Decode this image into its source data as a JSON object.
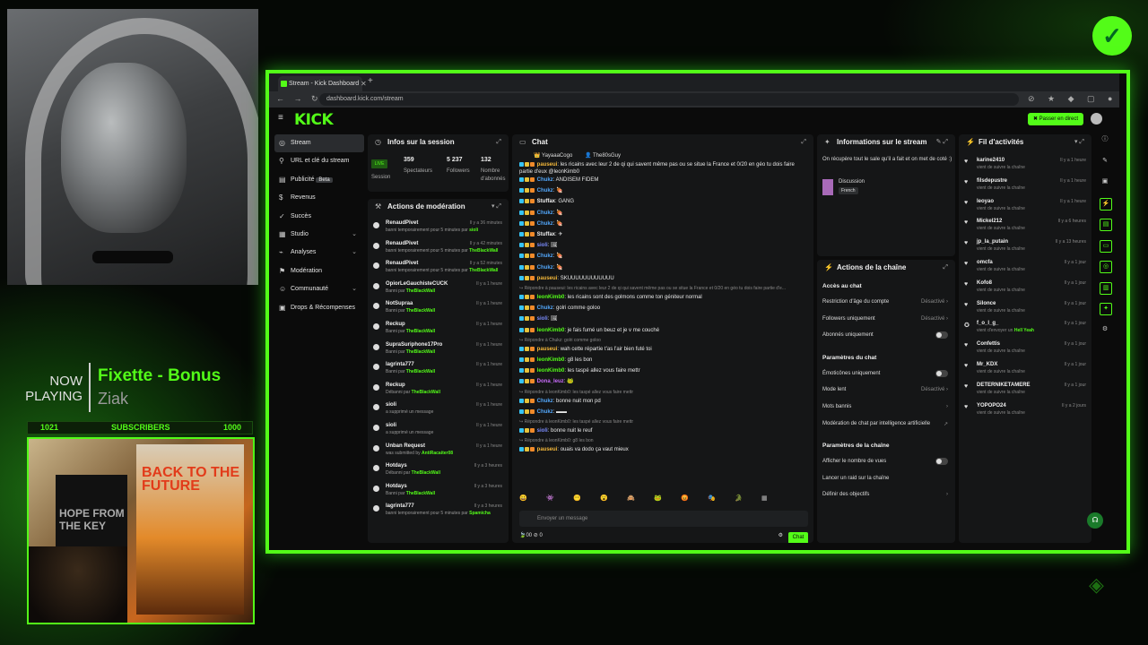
{
  "overlay": {
    "now": "NOW",
    "playing": "PLAYING",
    "song_title": "Fixette - Bonus",
    "artist": "Ziak",
    "sub_left": "1021",
    "sub_label": "SUBSCRIBERS",
    "sub_right": "1000",
    "poster_text_1": "BACK TO THE FUTURE",
    "poster_text_2": "HOPE FROM THE KEY"
  },
  "browser": {
    "tab_title": "Stream - Kick Dashboard",
    "url": "dashboard.kick.com/stream",
    "nav_icons": "← → ↻",
    "ext_icons": "⊘ ★ ◆ ▢ ●"
  },
  "app": {
    "logo": "KICK",
    "go_live": "✖ Passer en direct",
    "sidebar": [
      {
        "label": "Stream",
        "icon": "◎",
        "chev": ""
      },
      {
        "label": "URL et clé du stream",
        "icon": "⚲",
        "chev": ""
      },
      {
        "label": "Publicité",
        "icon": "▤",
        "chev": "",
        "badge": "Beta"
      },
      {
        "label": "Revenus",
        "icon": "$",
        "chev": ""
      },
      {
        "label": "Succès",
        "icon": "✓",
        "chev": ""
      },
      {
        "label": "Studio",
        "icon": "▦",
        "chev": "⌄"
      },
      {
        "label": "Analyses",
        "icon": "⌁",
        "chev": "⌄"
      },
      {
        "label": "Modération",
        "icon": "⚑",
        "chev": ""
      },
      {
        "label": "Communauté",
        "icon": "☺",
        "chev": "⌄"
      },
      {
        "label": "Drops & Récompenses",
        "icon": "▣",
        "chev": ""
      }
    ],
    "session": {
      "title": "Infos sur la session",
      "live_label": "LIVE",
      "session_label": "Session",
      "spectators_value": "359",
      "spectators_label": "Spectateurs",
      "followers_value": "5 237",
      "followers_label": "Followers",
      "subs_value": "132",
      "subs_label": "Nombre d'abonnés"
    },
    "moderation": {
      "title": "Actions de modération",
      "items": [
        {
          "user": "RenaudPivet",
          "time": "Il y a 36 minutes",
          "desc": "banni temporairement pour 5 minutes par ",
          "by": "sioli"
        },
        {
          "user": "RenaudPivet",
          "time": "Il y a 42 minutes",
          "desc": "banni temporairement pour 5 minutes par ",
          "by": "TheBlackWall"
        },
        {
          "user": "RenaudPivet",
          "time": "Il y a 52 minutes",
          "desc": "banni temporairement pour 5 minutes par ",
          "by": "TheBlackWall"
        },
        {
          "user": "OpiorLeGauchisteCUCK",
          "time": "Il y a 1 heure",
          "desc": "Banni par ",
          "by": "TheBlackWall"
        },
        {
          "user": "NotSupraa",
          "time": "Il y a 1 heure",
          "desc": "Banni par ",
          "by": "TheBlackWall"
        },
        {
          "user": "Reckup",
          "time": "Il y a 1 heure",
          "desc": "Banni par ",
          "by": "TheBlackWall"
        },
        {
          "user": "SupraSuriphone17Pro",
          "time": "Il y a 1 heure",
          "desc": "Banni par ",
          "by": "TheBlackWall"
        },
        {
          "user": "lagrinta777",
          "time": "Il y a 1 heure",
          "desc": "Banni par ",
          "by": "TheBlackWall"
        },
        {
          "user": "Reckup",
          "time": "Il y a 1 heure",
          "desc": "Débanni par ",
          "by": "TheBlackWall"
        },
        {
          "user": "sioli",
          "time": "Il y a 1 heure",
          "desc": "a supprimé un message",
          "by": ""
        },
        {
          "user": "sioli",
          "time": "Il y a 1 heure",
          "desc": "a supprimé un message",
          "by": ""
        },
        {
          "user": "Unban Request",
          "time": "Il y a 1 heure",
          "desc": "was submitted by ",
          "by": "AntiRacaiter08"
        },
        {
          "user": "Hotdays",
          "time": "Il y a 3 heures",
          "desc": "Débanni par ",
          "by": "TheBlackWall"
        },
        {
          "user": "Hotdays",
          "time": "Il y a 3 heures",
          "desc": "Banni par ",
          "by": "TheBlackWall"
        },
        {
          "user": "lagrinta777",
          "time": "Il y a 3 heures",
          "desc": "banni temporairement pour 5 minutes par ",
          "by": "Spamicha"
        }
      ]
    },
    "chat": {
      "title": "Chat",
      "pinned": [
        "👑 YayaaaCogo",
        "👤 The80sGuy"
      ],
      "messages": [
        {
          "kind": "msg",
          "user": "pauseui",
          "color": "#f5b93a",
          "text": ": les ricains avec leur 2 de qi qui savent même pas ou se situe la France et 0/20 en géo tu dois faire partie d'eux @leonKimb0"
        },
        {
          "kind": "msg",
          "user": "Chukz",
          "color": "#53a8fc",
          "text": ": ANDISEM FIDEM"
        },
        {
          "kind": "msg",
          "user": "Chukz",
          "color": "#53a8fc",
          "text": ": 🍖"
        },
        {
          "kind": "msg",
          "user": "Stuffax",
          "color": "#f0f0f0",
          "text": ": GANG"
        },
        {
          "kind": "msg",
          "user": "Chukz",
          "color": "#53a8fc",
          "text": ": 🍖"
        },
        {
          "kind": "msg",
          "user": "Chukz",
          "color": "#53a8fc",
          "text": ": 🍖"
        },
        {
          "kind": "msg",
          "user": "Stuffax",
          "color": "#f0f0f0",
          "text": ": ✈"
        },
        {
          "kind": "msg",
          "user": "sioli",
          "color": "#7b8cff",
          "text": ": 🖼"
        },
        {
          "kind": "msg",
          "user": "Chukz",
          "color": "#53a8fc",
          "text": ": 🍖"
        },
        {
          "kind": "msg",
          "user": "Chukz",
          "color": "#53a8fc",
          "text": ": 🍖"
        },
        {
          "kind": "msg",
          "user": "pauseui",
          "color": "#f5b93a",
          "text": ": SKUUUUUUUUUUUU"
        },
        {
          "kind": "reply",
          "text": "↪ Répondre à pauseui: les ricains avec leur 2 de qi qui savent même pas ou se situe la France et 0/20 en géo tu dois faire partie d'e..."
        },
        {
          "kind": "msg",
          "user": "leonKimb0",
          "color": "#53fc18",
          "text": ": les ricains sont des golmons comme ton géniteur normal"
        },
        {
          "kind": "msg",
          "user": "Chukz",
          "color": "#53a8fc",
          "text": ": golri comme goloo"
        },
        {
          "kind": "msg",
          "user": "sioli",
          "color": "#7b8cff",
          "text": ": 🖼"
        },
        {
          "kind": "msg",
          "user": "leonKimb0",
          "color": "#53fc18",
          "text": ": je fais fumé un beuz et je v me couché"
        },
        {
          "kind": "reply",
          "text": "↪ Répondre à Chukz: golri comme goloo"
        },
        {
          "kind": "msg",
          "user": "pauseui",
          "color": "#f5b93a",
          "text": ": wah cette répartie t'as l'air bien futé toi"
        },
        {
          "kind": "msg",
          "user": "leonKimb0",
          "color": "#53fc18",
          "text": ": g8 les bon"
        },
        {
          "kind": "msg",
          "user": "leonKimb0",
          "color": "#53fc18",
          "text": ": les taspé allez vous faire mettr"
        },
        {
          "kind": "msg",
          "user": "Dona_leuz",
          "color": "#c86bfa",
          "text": ": 🐸"
        },
        {
          "kind": "reply",
          "text": "↪ Répondre à leonKimb0: les taspé allez vous faire mettr"
        },
        {
          "kind": "msg",
          "user": "Chukz",
          "color": "#53a8fc",
          "text": ": bonne nuit mon pd"
        },
        {
          "kind": "msg",
          "user": "Chukz",
          "color": "#53a8fc",
          "text": ": ▬▬"
        },
        {
          "kind": "reply",
          "text": "↪ Répondre à leonKimb0: les taspé allez vous faire mettr"
        },
        {
          "kind": "msg",
          "user": "sioli",
          "color": "#7b8cff",
          "text": ": bonne nuit le reuf"
        },
        {
          "kind": "reply",
          "text": "↪ Répondre à leonKimb0: g8 les bon"
        },
        {
          "kind": "msg",
          "user": "pauseui",
          "color": "#f5b93a",
          "text": ": ouais va dodo ça vaut mieux"
        }
      ],
      "emojis": [
        "😀",
        "👾",
        "😶",
        "😮",
        "🙈",
        "🐸",
        "😡",
        "🎭",
        "🐊",
        "▦"
      ],
      "placeholder": "Envoyer un message",
      "footer_left": "🍃00   ⊘ 0",
      "send": "Chat"
    },
    "stream_info": {
      "title": "Informations sur le stream",
      "desc": "On récupère tout le sale qu'il a fait et on met de coté :)",
      "category": "Discussion",
      "tag": "French"
    },
    "channel_actions": {
      "title": "Actions de la chaîne",
      "sections": [
        {
          "title": "Accès au chat",
          "rows": [
            {
              "label": "Restriction d'âge du compte",
              "value": "Désactivé ›",
              "toggle": false
            },
            {
              "label": "Followers uniquement",
              "value": "Désactivé ›",
              "toggle": false
            },
            {
              "label": "Abonnés uniquement",
              "value": "",
              "toggle": true
            }
          ]
        },
        {
          "title": "Paramètres du chat",
          "rows": [
            {
              "label": "Émoticônes uniquement",
              "value": "",
              "toggle": true
            },
            {
              "label": "Mode lent",
              "value": "Désactivé ›",
              "toggle": false
            },
            {
              "label": "Mots bannis",
              "value": "›",
              "toggle": false
            },
            {
              "label": "Modération de chat par intelligence artificielle",
              "value": "↗",
              "toggle": false
            }
          ]
        },
        {
          "title": "Paramètres de la chaîne",
          "rows": [
            {
              "label": "Afficher le nombre de vues",
              "value": "",
              "toggle": true
            },
            {
              "label": "Lancer un raid sur la chaîne",
              "value": "",
              "toggle": false
            },
            {
              "label": "Définir des objectifs",
              "value": "›",
              "toggle": false
            }
          ]
        }
      ]
    },
    "activity": {
      "title": "Fil d'activités",
      "items": [
        {
          "name": "karine2410",
          "time": "Il y a 1 heure",
          "desc": "vient de suivre la chaîne",
          "extra": ""
        },
        {
          "name": "filsdepustre",
          "time": "Il y a 1 heure",
          "desc": "vient de suivre la chaîne",
          "extra": ""
        },
        {
          "name": "leoyao",
          "time": "Il y a 1 heure",
          "desc": "vient de suivre la chaîne",
          "extra": ""
        },
        {
          "name": "Mickel212",
          "time": "Il y a 6 heures",
          "desc": "vient de suivre la chaîne",
          "extra": ""
        },
        {
          "name": "jp_la_putain",
          "time": "Il y a 13 heures",
          "desc": "vient de suivre la chaîne",
          "extra": ""
        },
        {
          "name": "omcfa",
          "time": "Il y a 1 jour",
          "desc": "vient de suivre la chaîne",
          "extra": ""
        },
        {
          "name": "Kofo8",
          "time": "Il y a 1 jour",
          "desc": "vient de suivre la chaîne",
          "extra": ""
        },
        {
          "name": "Silonce",
          "time": "Il y a 1 jour",
          "desc": "vient de suivre la chaîne",
          "extra": ""
        },
        {
          "name": "f_o_l_g_",
          "time": "Il y a 1 jour",
          "desc": "vient d'envoyer un ",
          "extra": "Hell Yeah"
        },
        {
          "name": "Confettis",
          "time": "Il y a 1 jour",
          "desc": "vient de suivre la chaîne",
          "extra": ""
        },
        {
          "name": "Mr_KDX",
          "time": "Il y a 1 jour",
          "desc": "vient de suivre la chaîne",
          "extra": ""
        },
        {
          "name": "DETERNIKETAMERE",
          "time": "Il y a 1 jour",
          "desc": "vient de suivre la chaîne",
          "extra": ""
        },
        {
          "name": "YOPOPO24",
          "time": "Il y a 2 jours",
          "desc": "vient de suivre la chaîne",
          "extra": ""
        }
      ]
    },
    "rail_icons": [
      "ⓘ",
      "✎",
      "▣",
      "⚡",
      "▤",
      "▭",
      "◎",
      "▥",
      "✦",
      "⚙"
    ]
  }
}
